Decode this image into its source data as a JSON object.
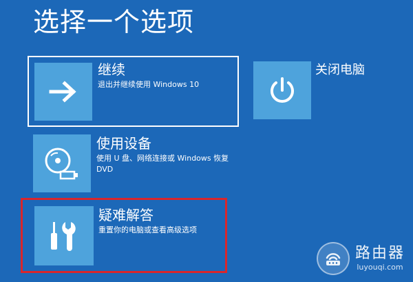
{
  "page": {
    "title": "选择一个选项"
  },
  "options": {
    "continue": {
      "icon": "arrow-right-icon",
      "title": "继续",
      "description": "退出并继续使用 Windows 10"
    },
    "use_device": {
      "icon": "disc-usb-icon",
      "title": "使用设备",
      "description": "使用 U 盘、网络连接或 Windows 恢复 DVD"
    },
    "troubleshoot": {
      "icon": "wrench-screwdriver-icon",
      "title": "疑难解答",
      "description": "重置你的电脑或查看高级选项"
    },
    "shutdown": {
      "icon": "power-icon",
      "title": "关闭电脑"
    }
  },
  "watermark": {
    "name": "路由器",
    "url": "luyouqi.com"
  },
  "colors": {
    "background": "#1c68b8",
    "tile": "#4ea3dc",
    "highlight_border": "#d9262c",
    "selected_border": "#ffffff"
  }
}
